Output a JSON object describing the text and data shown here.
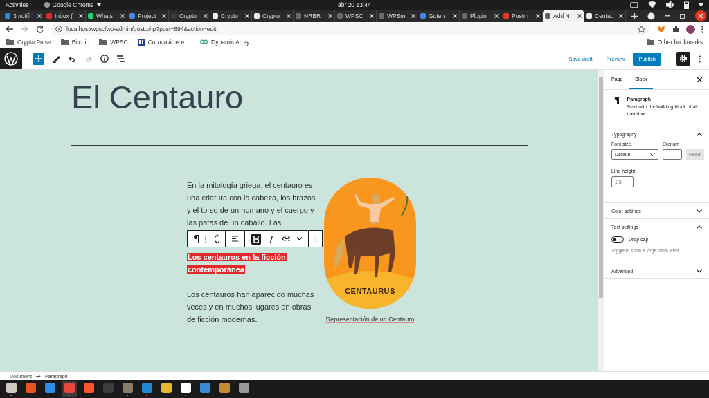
{
  "system_bar": {
    "activities": "Activities",
    "app_name": "Google Chrome",
    "clock": "abr 20  13:44"
  },
  "browser_tabs": [
    {
      "label": "3 notifi",
      "selected": false,
      "color": "#1a8fe3"
    },
    {
      "label": "Inbox (",
      "selected": false,
      "color": "#d93025"
    },
    {
      "label": "Whats",
      "selected": false,
      "color": "#25d366"
    },
    {
      "label": "Project",
      "selected": false,
      "color": "#4285f4"
    },
    {
      "label": "Crypto",
      "selected": false,
      "color": "#3a3a3a"
    },
    {
      "label": "Crypto",
      "selected": false,
      "color": "#f0f0f0"
    },
    {
      "label": "Crypto",
      "selected": false,
      "color": "#f0f0f0"
    },
    {
      "label": "NRBR",
      "selected": false,
      "color": "#6b6b6b"
    },
    {
      "label": "WPSC",
      "selected": false,
      "color": "#6b6b6b"
    },
    {
      "label": "WPSm",
      "selected": false,
      "color": "#6b6b6b"
    },
    {
      "label": "Guten",
      "selected": false,
      "color": "#4285f4"
    },
    {
      "label": "Plugin",
      "selected": false,
      "color": "#6b6b6b"
    },
    {
      "label": "Postm",
      "selected": false,
      "color": "#e8362c"
    },
    {
      "label": "Add N",
      "selected": true,
      "color": "#5f6368"
    },
    {
      "label": "Centau",
      "selected": false,
      "color": "#f0f0f0"
    }
  ],
  "address_bar": {
    "url": "localhost/wpsc/wp-admin/post.php?post=894&action=edit"
  },
  "bookmarks": [
    {
      "label": "Crypto Pulse",
      "kind": "folder"
    },
    {
      "label": "Bitcoin",
      "kind": "folder"
    },
    {
      "label": "WPSC",
      "kind": "folder"
    },
    {
      "label": "Coronavirus e…",
      "kind": "page"
    },
    {
      "label": "Dynamic Array…",
      "kind": "link"
    }
  ],
  "other_bookmarks": "Other bookmarks",
  "editor_toolbar": {
    "save_draft": "Save draft",
    "preview": "Preview",
    "publish": "Publish"
  },
  "post": {
    "title": "El Centauro",
    "paragraph_1": "En la mitología griega, el centauro es una criatura con la cabeza, los brazos y el torso de un humano y el cuerpo y las patas de un caballo. Las",
    "heading": "Los centauros en la ficción contemporánea",
    "paragraph_2": "Los centauros han aparecido muchas veces y en muchos lugares en obras de ficción modernas.",
    "image_label": "CENTAURUS",
    "caption": "Representación de un Centauro"
  },
  "block_toolbar": {
    "bold": {
      "selected": true
    },
    "italic": {
      "selected": false
    }
  },
  "sidebar": {
    "tabs": [
      {
        "label": "Page",
        "selected": false
      },
      {
        "label": "Block",
        "selected": true
      }
    ],
    "block_card": {
      "title": "Paragraph",
      "description": "Start with the building block of all narrative."
    },
    "panels": [
      {
        "kind": "typography",
        "title": "Typography",
        "expanded": true,
        "font_size_label": "Font size",
        "font_size_value": "Default",
        "custom_label": "Custom",
        "reset": "Reset",
        "line_height_label": "Line height",
        "line_height_placeholder": "1.5"
      },
      {
        "kind": "plain",
        "title": "Color settings",
        "expanded": false
      },
      {
        "kind": "text",
        "title": "Text settings",
        "expanded": true,
        "toggle_label": "Drop cap",
        "toggle_on": false,
        "help": "Toggle to show a large initial letter."
      },
      {
        "kind": "plain",
        "title": "Advanced",
        "expanded": false
      }
    ]
  },
  "breadcrumb": [
    "Document",
    "Paragraph"
  ],
  "dock": [
    {
      "color": "#cfcac2",
      "running": true,
      "selected": false
    },
    {
      "color": "#e95420",
      "running": false,
      "selected": false
    },
    {
      "color": "#2b8ee6",
      "running": false,
      "selected": false
    },
    {
      "color": "#e8453c",
      "running": true,
      "selected": true
    },
    {
      "color": "#fb542b",
      "running": false,
      "selected": false
    },
    {
      "color": "#3c3c3c",
      "running": false,
      "selected": false
    },
    {
      "color": "#8a7f66",
      "running": true,
      "selected": false
    },
    {
      "color": "#1f8ad2",
      "running": true,
      "selected": false
    },
    {
      "color": "#e6b830",
      "running": false,
      "selected": false
    },
    {
      "color": "#ffffff",
      "running": true,
      "selected": false
    },
    {
      "color": "#3c8ad8",
      "running": false,
      "selected": false
    },
    {
      "color": "#c58c2d",
      "running": false,
      "selected": false
    },
    {
      "color": "#9a9a9a",
      "running": false,
      "selected": false
    }
  ]
}
